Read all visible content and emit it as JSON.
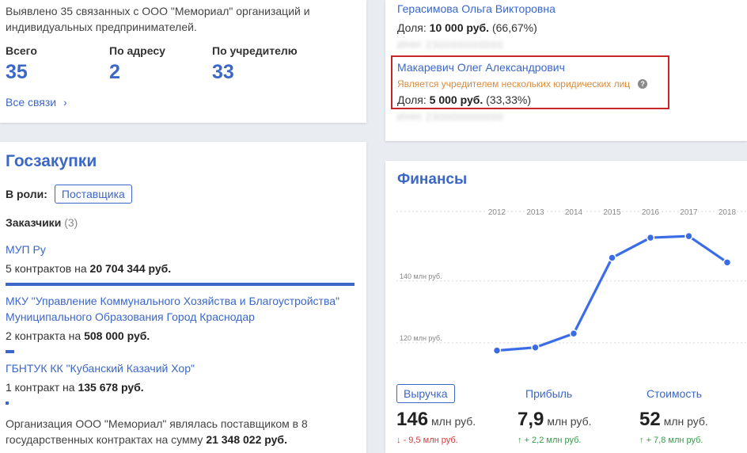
{
  "links": {
    "intro": "Выявлено 35 связанных с ООО \"Мемориал\" организаций и индивидуальных предпринимателей.",
    "stats": [
      {
        "label": "Всего",
        "value": "35"
      },
      {
        "label": "По адресу",
        "value": "2"
      },
      {
        "label": "По учредителю",
        "value": "33"
      }
    ],
    "all_link": "Все связи",
    "all_link_icon": "chevron-right-icon"
  },
  "zakupki": {
    "title": "Госзакупки",
    "role_label": "В роли:",
    "role_value": "Поставщика",
    "customers_label": "Заказчики",
    "customers_count": "(3)",
    "customers": [
      {
        "name": "МУП Ру",
        "prefix": "5 контрактов на",
        "amount": "20 704 344 руб.",
        "bar_fraction": 1.0
      },
      {
        "name": "МКУ \"Управление Коммунального Хозяйства и Благоустройства\" Муниципального Образования Город Краснодар",
        "prefix": "2 контракта на",
        "amount": "508 000 руб.",
        "bar_fraction": 0.025
      },
      {
        "name": "ГБНТУК КК \"Кубанский Казачий Хор\"",
        "prefix": "1 контракт на",
        "amount": "135 678 руб.",
        "bar_fraction": 0.007
      }
    ],
    "note_text": "Организация ООО \"Мемориал\" являлась поставщиком в 8 государственных контрактах на сумму",
    "note_amount": "21 348 022 руб."
  },
  "founders": [
    {
      "name": "Герасимова Ольга Викторовна",
      "share_label": "Доля:",
      "share_amount": "10 000 руб.",
      "share_pct": "(66,67%)",
      "inn": "ИНН 230000000000"
    },
    {
      "name": "Макаревич Олег Александрович",
      "warning": "Является учредителем нескольких юридических лиц",
      "share_label": "Доля:",
      "share_amount": "5 000 руб.",
      "share_pct": "(33,33%)",
      "inn": "ИНН 230000000000"
    }
  ],
  "finance": {
    "title": "Финансы",
    "tabs": [
      "Выручка",
      "Прибыль",
      "Стоимость"
    ],
    "metrics": [
      {
        "value": "146",
        "unit": "млн руб.",
        "change_dir": "down",
        "change": "- 9,5 млн руб."
      },
      {
        "value": "7,9",
        "unit": "млн руб.",
        "change_dir": "up",
        "change": "+ 2,2 млн руб."
      },
      {
        "value": "52",
        "unit": "млн руб.",
        "change_dir": "up",
        "change": "+ 7,8 млн руб."
      }
    ],
    "colors": {
      "accent": "#3b67c8",
      "line": "#3a6be6",
      "down": "#d23b3b",
      "up": "#3a9a4b"
    }
  },
  "chart_data": {
    "type": "line",
    "title": "",
    "x": [
      "2012",
      "2013",
      "2014",
      "2015",
      "2016",
      "2017",
      "2018"
    ],
    "series": [
      {
        "values": [
          117.5,
          118.5,
          123,
          147.5,
          154,
          154.5,
          146
        ]
      }
    ],
    "ytick_labels": [
      "120 млн руб.",
      "140 млн руб."
    ],
    "yticks": [
      120,
      140
    ],
    "ylim": [
      111,
      163
    ],
    "grid": true,
    "legend": "none"
  }
}
